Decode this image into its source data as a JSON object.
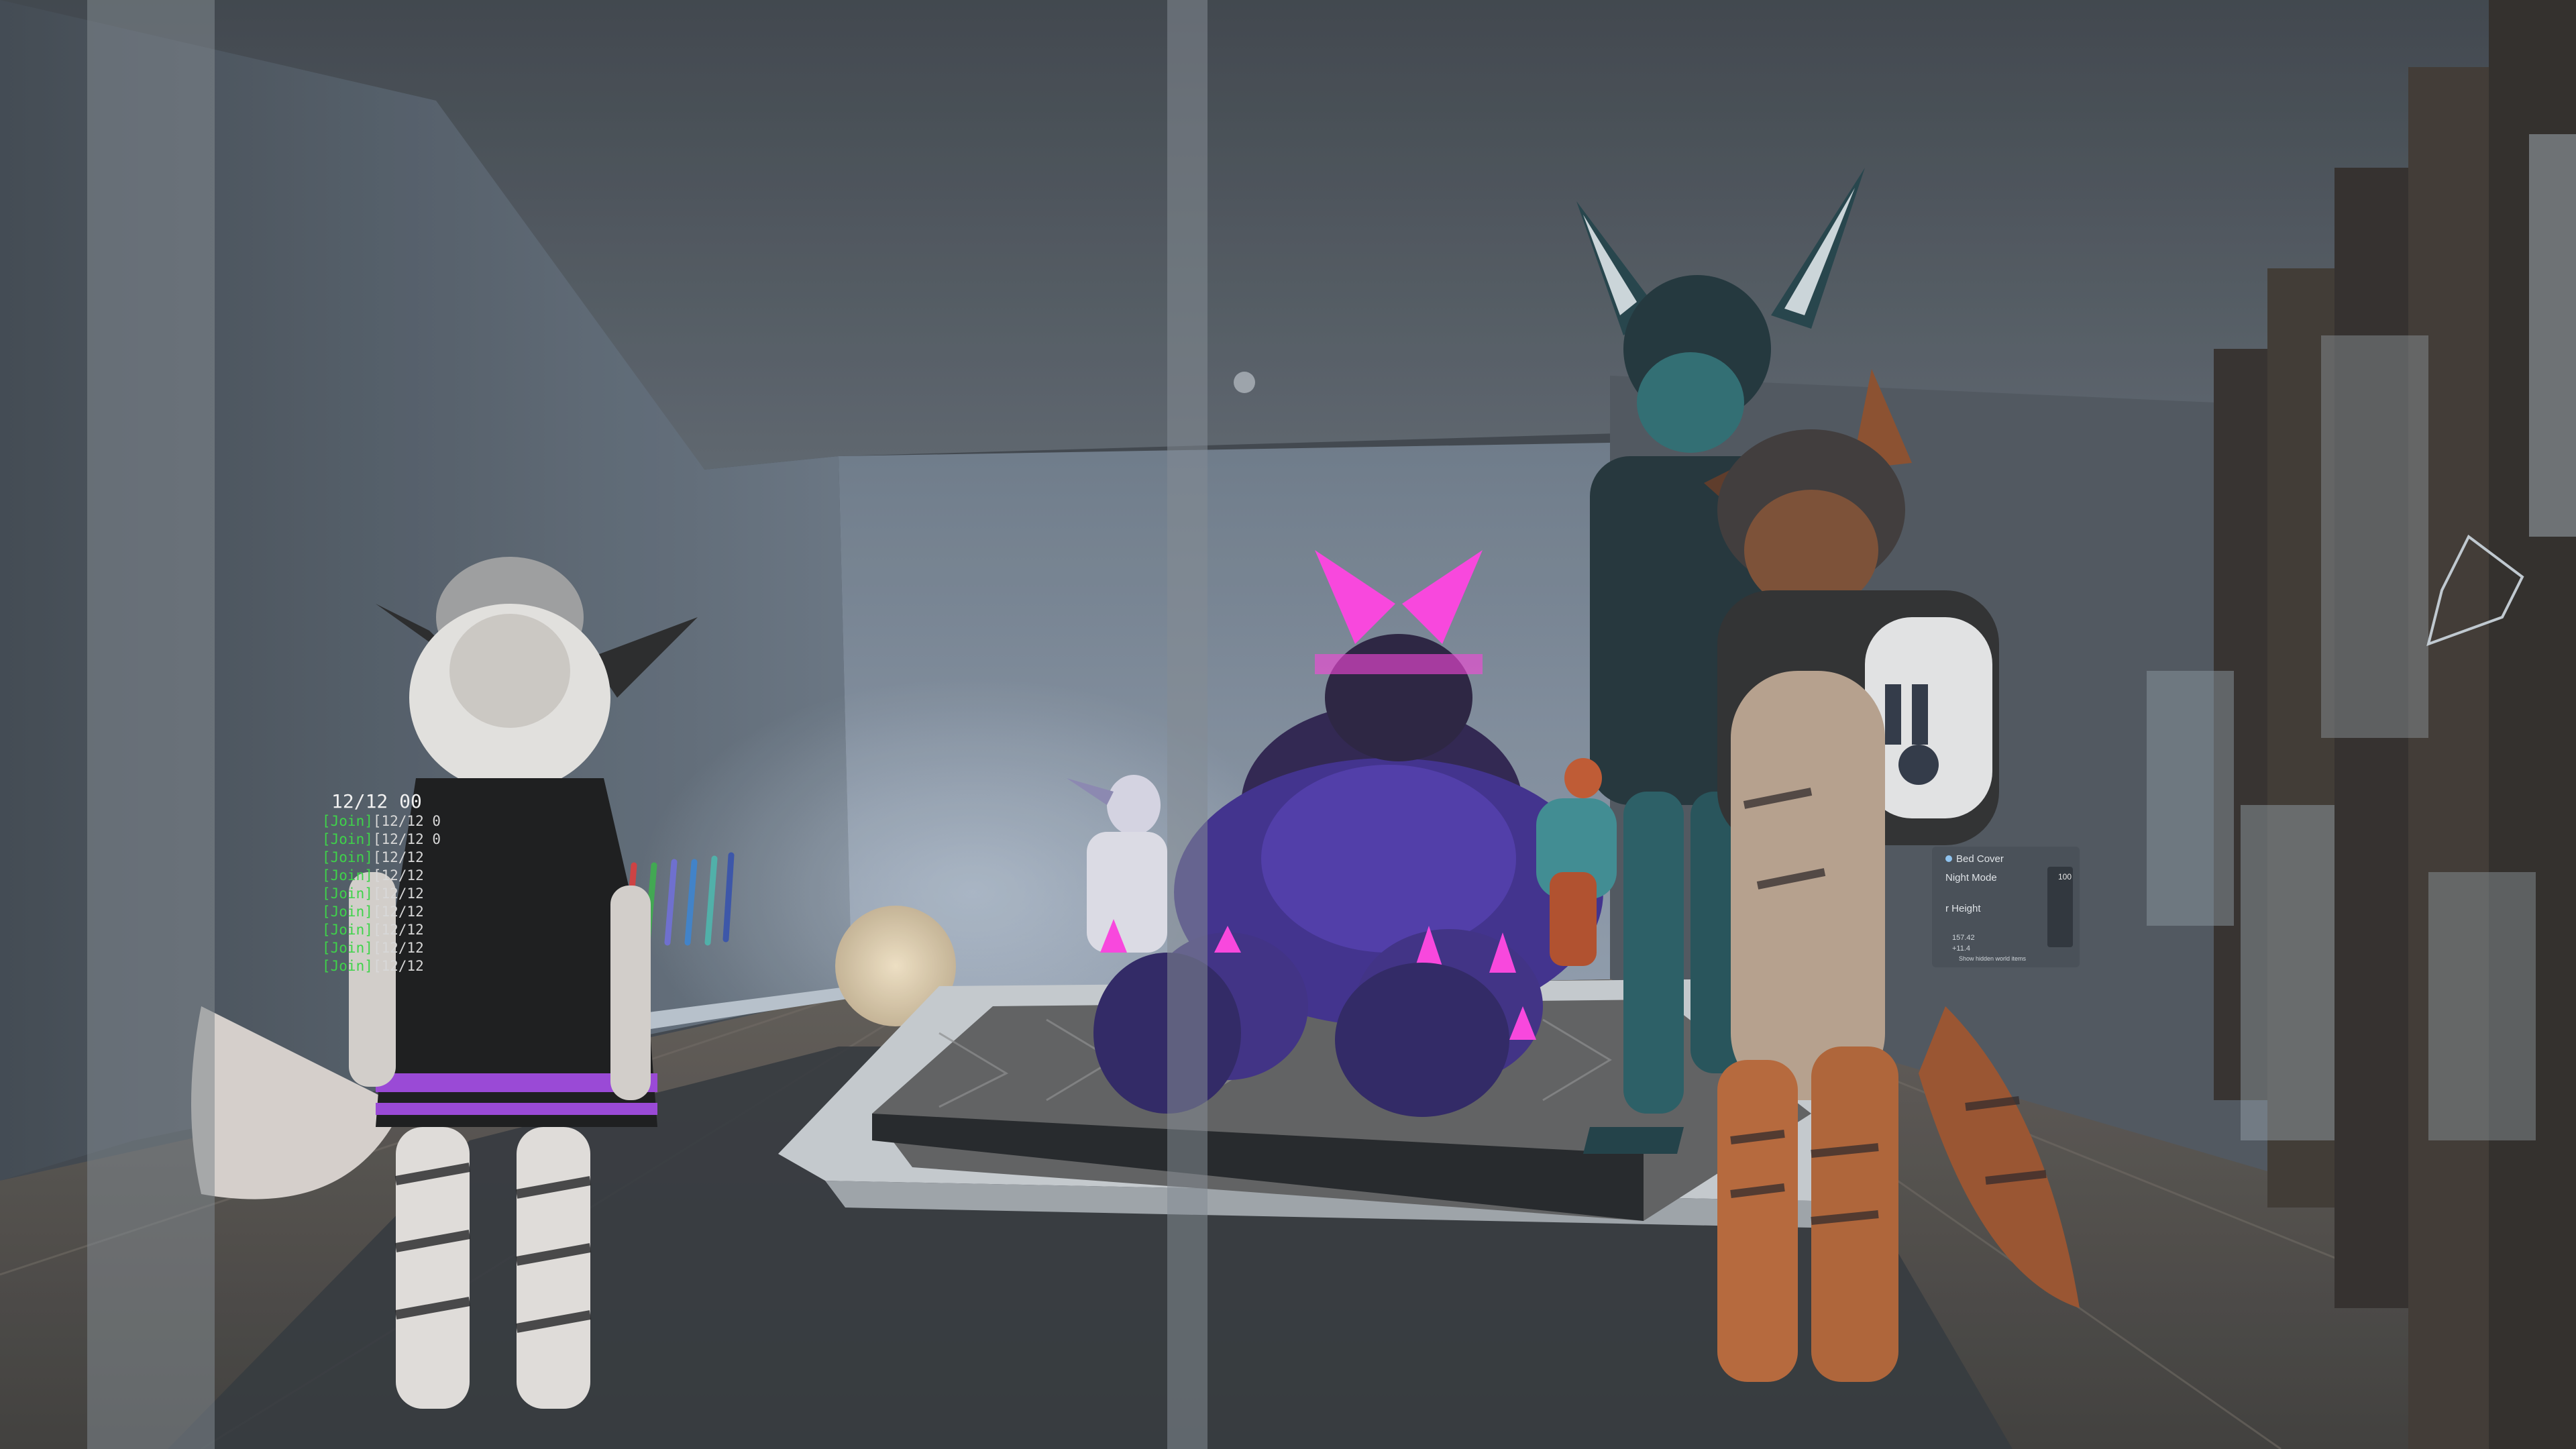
{
  "join_log": {
    "header": "12/12 00",
    "rows": [
      {
        "tag": "[Join]",
        "ts": "[12/12 0"
      },
      {
        "tag": "[Join]",
        "ts": "[12/12 0"
      },
      {
        "tag": "[Join]",
        "ts": "[12/12"
      },
      {
        "tag": "[Join]",
        "ts": "[12/12"
      },
      {
        "tag": "[Join]",
        "ts": "[12/12"
      },
      {
        "tag": "[Join]",
        "ts": "[12/12"
      },
      {
        "tag": "[Join]",
        "ts": "[12/12"
      },
      {
        "tag": "[Join]",
        "ts": "[12/12"
      },
      {
        "tag": "[Join]",
        "ts": "[12/12"
      }
    ]
  },
  "bed_panel": {
    "options": [
      "Bed Cover",
      "Night Mode",
      "r Height"
    ],
    "slider_value": "100",
    "readout_1": "157.42",
    "readout_2": "+11.4",
    "footnote": "Show hidden world items"
  },
  "colors": {
    "join_tag": "#3fd34a",
    "neon_accent": "#ff3fe0",
    "fox_orange": "#b86434"
  }
}
